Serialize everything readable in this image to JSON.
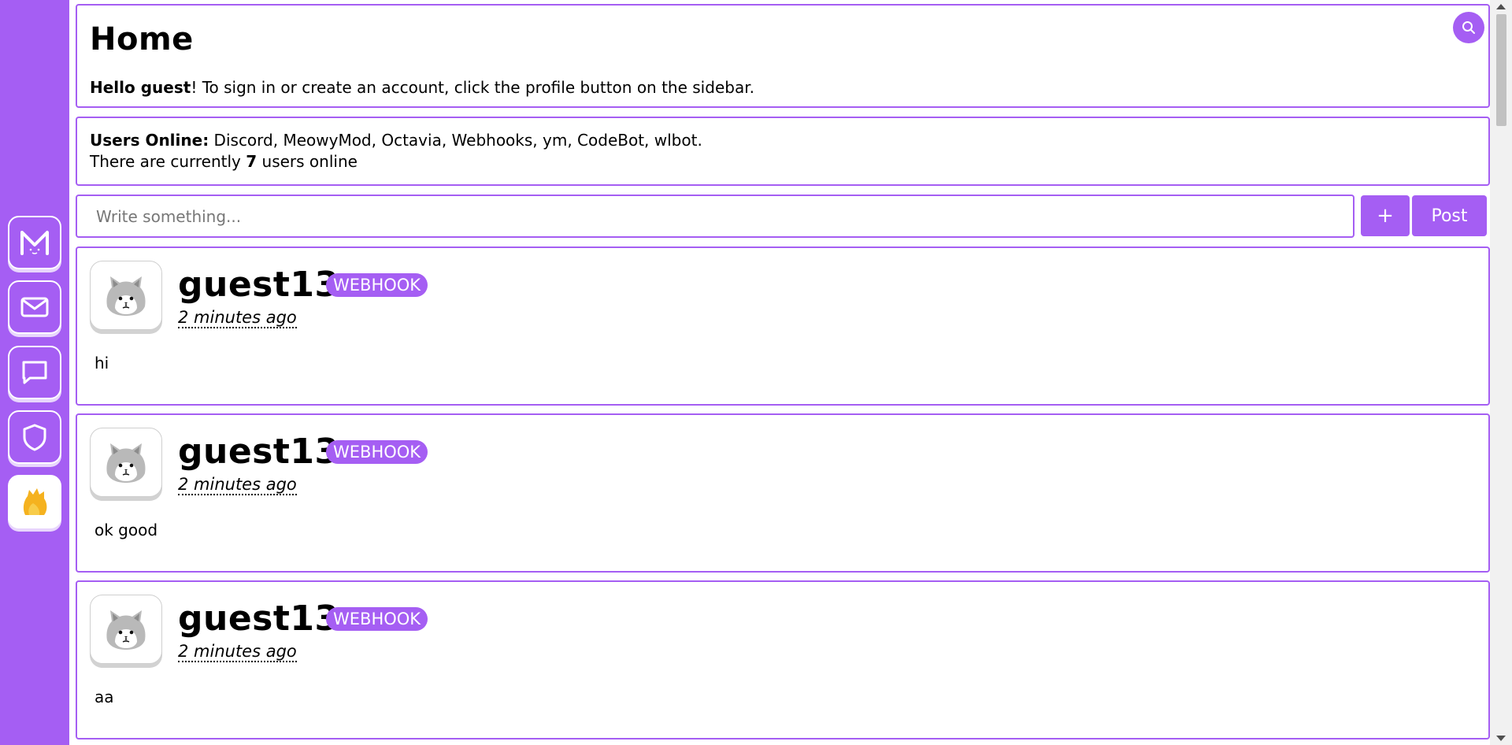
{
  "sidebar": {
    "items": [
      {
        "name": "meowy-logo-icon"
      },
      {
        "name": "mail-icon"
      },
      {
        "name": "chat-icon"
      },
      {
        "name": "shield-icon"
      },
      {
        "name": "profile-icon"
      }
    ]
  },
  "header": {
    "title": "Home",
    "greeting_bold": "Hello guest",
    "greeting_rest": "! To sign in or create an account, click the profile button on the sidebar.",
    "search_icon": "search-icon"
  },
  "online": {
    "label": "Users Online:",
    "users": " Discord, MeowyMod, Octavia, Webhooks, ym, CodeBot, wlbot.",
    "count_prefix": "There are currently ",
    "count": "7",
    "count_suffix": " users online"
  },
  "composer": {
    "placeholder": "Write something...",
    "plus_label": "+",
    "post_label": "Post"
  },
  "posts": [
    {
      "username": "guest13",
      "badge": "WEBHOOK",
      "time": "2 minutes ago",
      "text": "hi"
    },
    {
      "username": "guest13",
      "badge": "WEBHOOK",
      "time": "2 minutes ago",
      "text": "ok good"
    },
    {
      "username": "guest13",
      "badge": "WEBHOOK",
      "time": "2 minutes ago",
      "text": "aa"
    }
  ],
  "colors": {
    "accent": "#a55ef3",
    "background": "#ffffff"
  }
}
